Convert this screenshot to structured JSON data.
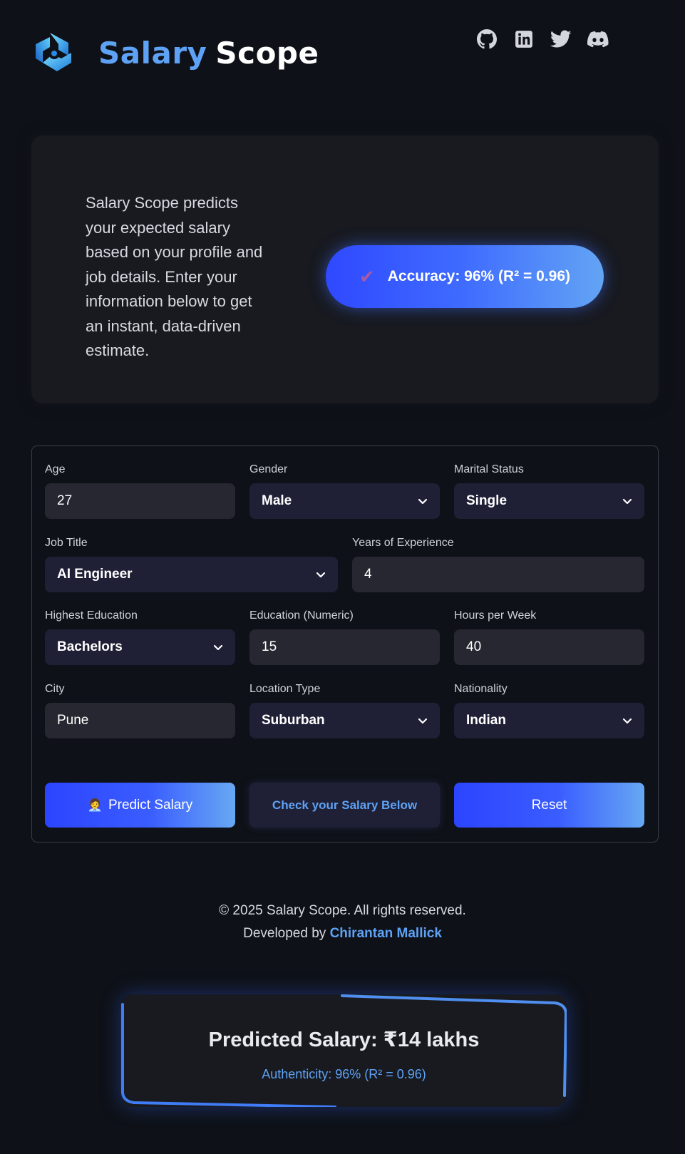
{
  "header": {
    "brand_part1": "Salary",
    "brand_part2": "Scope",
    "social_icons": [
      "github-icon",
      "linkedin-icon",
      "twitter-icon",
      "discord-icon"
    ]
  },
  "hero": {
    "description": "Salary Scope predicts your expected salary based on your profile and job details. Enter your information below to get an instant, data-driven estimate.",
    "accuracy_label": "Accuracy: 96% (R² = 0.96)",
    "accuracy_icon": "checkmark-icon"
  },
  "form": {
    "age": {
      "label": "Age",
      "value": "27"
    },
    "gender": {
      "label": "Gender",
      "value": "Male"
    },
    "marital_status": {
      "label": "Marital Status",
      "value": "Single"
    },
    "job_title": {
      "label": "Job Title",
      "value": "AI Engineer"
    },
    "years_experience": {
      "label": "Years of Experience",
      "value": "4"
    },
    "highest_education": {
      "label": "Highest Education",
      "value": "Bachelors"
    },
    "education_numeric": {
      "label": "Education (Numeric)",
      "value": "15"
    },
    "hours_per_week": {
      "label": "Hours per Week",
      "value": "40"
    },
    "city": {
      "label": "City",
      "value": "Pune"
    },
    "location_type": {
      "label": "Location Type",
      "value": "Suburban"
    },
    "nationality": {
      "label": "Nationality",
      "value": "Indian"
    }
  },
  "buttons": {
    "predict_emoji": "🧑‍💼",
    "predict": "Predict Salary",
    "check": "Check your Salary Below",
    "reset": "Reset"
  },
  "footer": {
    "copyright": "© 2025 Salary Scope. All rights reserved.",
    "developed_by": "Developed by",
    "author": "Chirantan Mallick"
  },
  "result": {
    "title": "Predicted Salary: ₹14 lakhs",
    "subtitle": "Authenticity: 96% (R² = 0.96)"
  },
  "colors": {
    "background": "#0e1117",
    "accent": "#5ea2f5",
    "button_gradient_start": "#2c44ff",
    "button_gradient_end": "#67a8f3"
  }
}
